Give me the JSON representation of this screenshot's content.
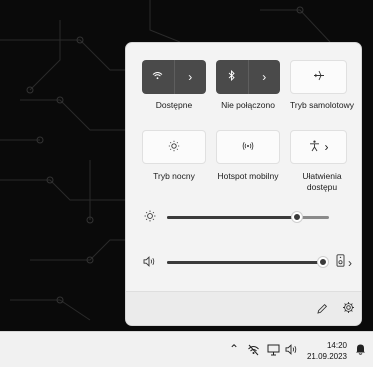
{
  "quick_settings": {
    "tiles": [
      {
        "label": "Dostępne",
        "state": "on",
        "icon": "wifi-icon"
      },
      {
        "label": "Nie połączono",
        "state": "on",
        "icon": "bluetooth-icon"
      },
      {
        "label": "Tryb samolotowy",
        "state": "off",
        "icon": "airplane-icon"
      },
      {
        "label": "Tryb nocny",
        "state": "off",
        "icon": "night-light-icon"
      },
      {
        "label": "Hotspot mobilny",
        "state": "off",
        "icon": "hotspot-icon"
      },
      {
        "label": "Ułatwienia dostępu",
        "state": "off",
        "icon": "accessibility-icon"
      }
    ],
    "brightness": {
      "level": 0.8
    },
    "volume": {
      "level": 1.0
    }
  },
  "taskbar": {
    "time": "14:20",
    "date": "21.09.2023"
  },
  "colors": {
    "tile_on": "#4a4a4a",
    "panel_bg": "#f3f3f3"
  }
}
